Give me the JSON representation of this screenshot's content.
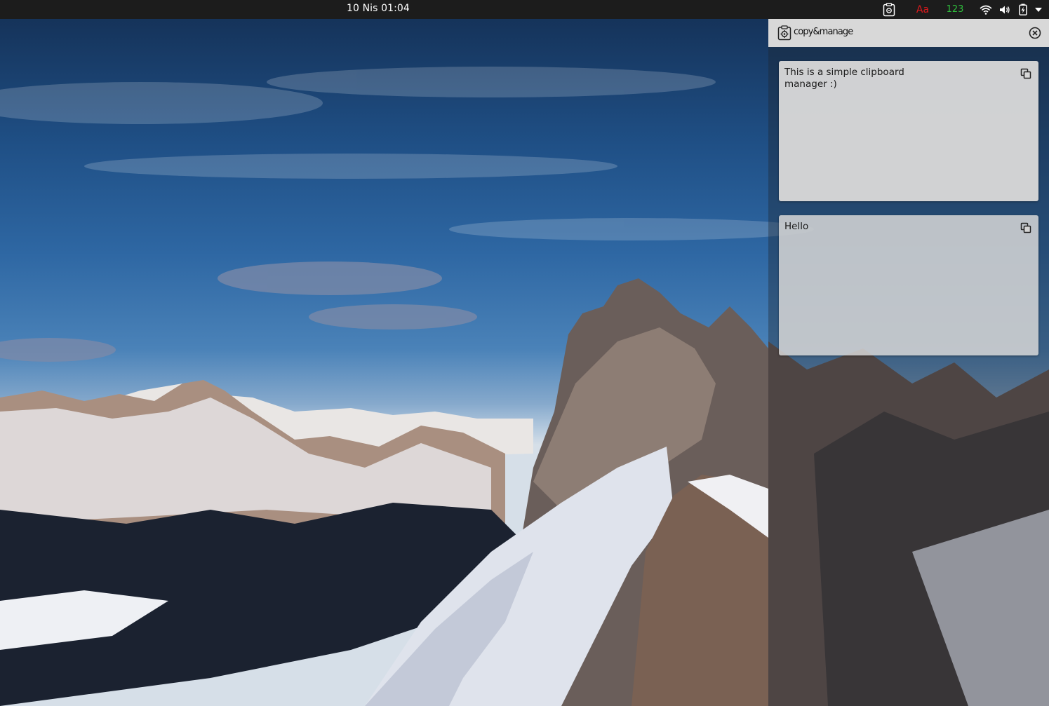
{
  "topbar": {
    "clock": "10 Nis  01:04",
    "tray": {
      "clipboard_icon": "clipboard-manager-icon",
      "text_indicator": "Aa",
      "number_indicator": "123",
      "wifi_icon": "wifi-icon",
      "volume_icon": "volume-icon",
      "battery_icon": "battery-charging-icon",
      "menu_icon": "chevron-down-icon"
    },
    "colors": {
      "text_indicator": "#e0191c",
      "number_indicator": "#2fbd3c"
    }
  },
  "panel": {
    "title": "copy&manage",
    "logo_icon": "clipboard-gear-icon",
    "close_icon": "close-circle-icon",
    "items": [
      {
        "text": "This is a simple clipboard\nmanager :)",
        "copy_icon": "copy-icon"
      },
      {
        "text": "Hello",
        "copy_icon": "copy-icon"
      }
    ]
  }
}
